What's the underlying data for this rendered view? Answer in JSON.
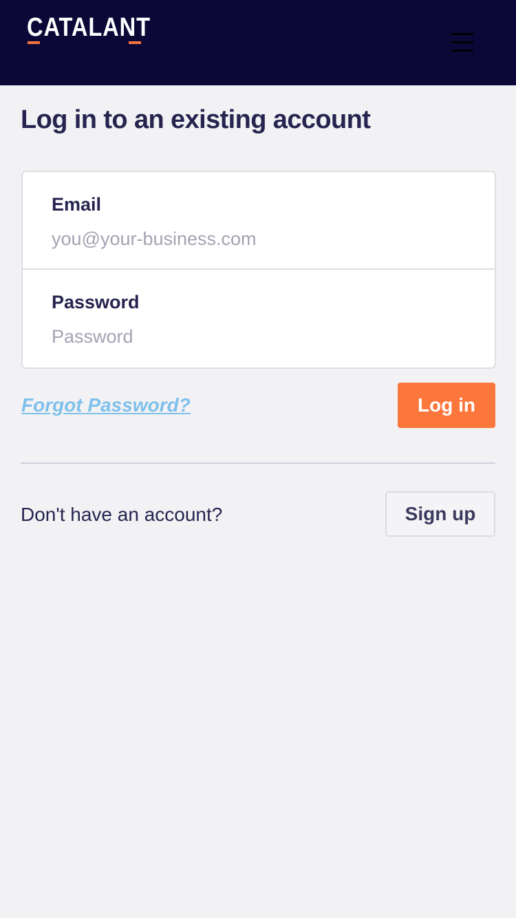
{
  "header": {
    "logo_text": "CATALANT",
    "menu_icon": "hamburger-menu-icon",
    "background_color": "#0b0838",
    "logo_accent_color": "#f7743e"
  },
  "main": {
    "title": "Log in to an existing account",
    "form": {
      "email": {
        "label": "Email",
        "placeholder": "you@your-business.com",
        "value": ""
      },
      "password": {
        "label": "Password",
        "placeholder": "Password",
        "value": ""
      }
    },
    "forgot_password_label": "Forgot Password?",
    "login_button_label": "Log in",
    "signup_prompt": "Don't have an account?",
    "signup_button_label": "Sign up"
  },
  "colors": {
    "page_background": "#f2f2f4",
    "primary_button": "#fb773c",
    "link": "#7fc0eb",
    "text": "#26244f"
  }
}
